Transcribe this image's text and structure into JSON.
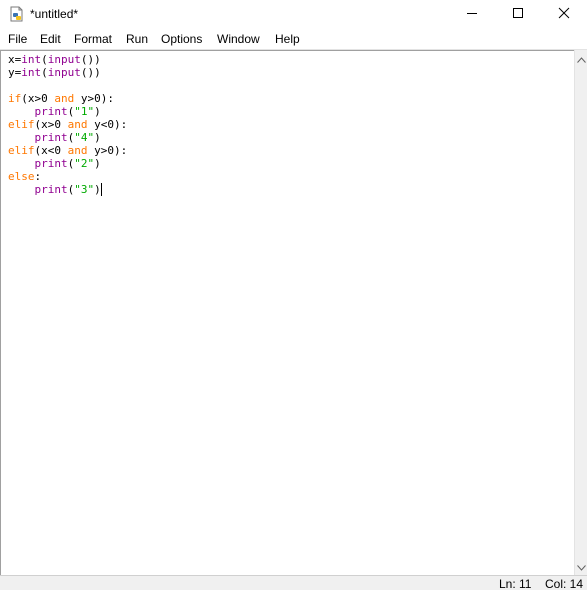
{
  "window": {
    "title": "*untitled*",
    "app_icon": "python-idle-icon"
  },
  "window_controls": {
    "minimize_icon": "minimize-icon",
    "maximize_icon": "maximize-icon",
    "close_icon": "close-icon"
  },
  "menu": {
    "items": [
      {
        "label": "File"
      },
      {
        "label": "Edit"
      },
      {
        "label": "Format"
      },
      {
        "label": "Run"
      },
      {
        "label": "Options"
      },
      {
        "label": "Window"
      },
      {
        "label": "Help"
      }
    ]
  },
  "editor": {
    "lines": [
      {
        "tokens": [
          {
            "text": "x=",
            "cls": ""
          },
          {
            "text": "int",
            "cls": "bi"
          },
          {
            "text": "(",
            "cls": ""
          },
          {
            "text": "input",
            "cls": "bi"
          },
          {
            "text": "())",
            "cls": ""
          }
        ]
      },
      {
        "tokens": [
          {
            "text": "y=",
            "cls": ""
          },
          {
            "text": "int",
            "cls": "bi"
          },
          {
            "text": "(",
            "cls": ""
          },
          {
            "text": "input",
            "cls": "bi"
          },
          {
            "text": "())",
            "cls": ""
          }
        ]
      },
      {
        "tokens": []
      },
      {
        "tokens": [
          {
            "text": "if",
            "cls": "kw"
          },
          {
            "text": "(x>0 ",
            "cls": ""
          },
          {
            "text": "and",
            "cls": "kw"
          },
          {
            "text": " y>0):",
            "cls": ""
          }
        ]
      },
      {
        "tokens": [
          {
            "text": "    ",
            "cls": ""
          },
          {
            "text": "print",
            "cls": "bi"
          },
          {
            "text": "(",
            "cls": ""
          },
          {
            "text": "\"1\"",
            "cls": "str"
          },
          {
            "text": ")",
            "cls": ""
          }
        ]
      },
      {
        "tokens": [
          {
            "text": "elif",
            "cls": "kw"
          },
          {
            "text": "(x>0 ",
            "cls": ""
          },
          {
            "text": "and",
            "cls": "kw"
          },
          {
            "text": " y<0):",
            "cls": ""
          }
        ]
      },
      {
        "tokens": [
          {
            "text": "    ",
            "cls": ""
          },
          {
            "text": "print",
            "cls": "bi"
          },
          {
            "text": "(",
            "cls": ""
          },
          {
            "text": "\"4\"",
            "cls": "str"
          },
          {
            "text": ")",
            "cls": ""
          }
        ]
      },
      {
        "tokens": [
          {
            "text": "elif",
            "cls": "kw"
          },
          {
            "text": "(x<0 ",
            "cls": ""
          },
          {
            "text": "and",
            "cls": "kw"
          },
          {
            "text": " y>0):",
            "cls": ""
          }
        ]
      },
      {
        "tokens": [
          {
            "text": "    ",
            "cls": ""
          },
          {
            "text": "print",
            "cls": "bi"
          },
          {
            "text": "(",
            "cls": ""
          },
          {
            "text": "\"2\"",
            "cls": "str"
          },
          {
            "text": ")",
            "cls": ""
          }
        ]
      },
      {
        "tokens": [
          {
            "text": "else",
            "cls": "kw"
          },
          {
            "text": ":",
            "cls": ""
          }
        ]
      },
      {
        "tokens": [
          {
            "text": "    ",
            "cls": ""
          },
          {
            "text": "print",
            "cls": "bi"
          },
          {
            "text": "(",
            "cls": ""
          },
          {
            "text": "\"3\"",
            "cls": "str"
          },
          {
            "text": ")",
            "cls": ""
          }
        ],
        "cursor": true
      }
    ],
    "colors": {
      "keyword": "#ff7700",
      "builtin": "#900090",
      "string": "#00aa00",
      "text": "#000000"
    }
  },
  "status": {
    "line": "Ln: 11",
    "col": "Col: 14"
  }
}
